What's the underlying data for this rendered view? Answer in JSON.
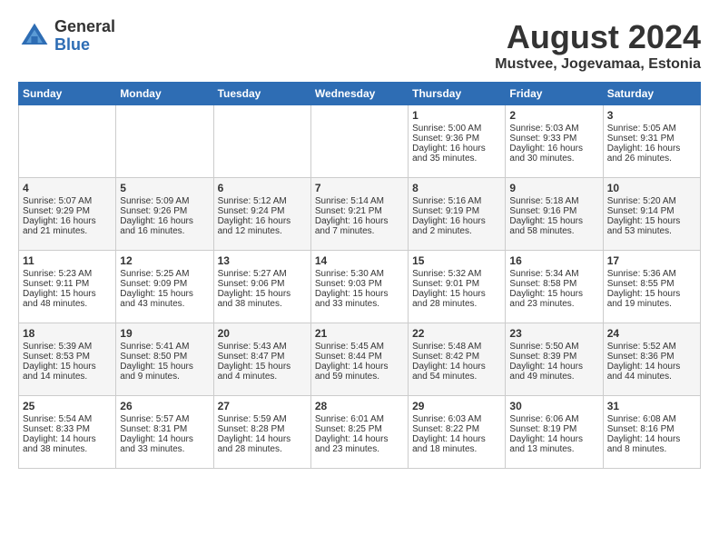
{
  "header": {
    "logo_general": "General",
    "logo_blue": "Blue",
    "month_year": "August 2024",
    "location": "Mustvee, Jogevamaa, Estonia"
  },
  "days_of_week": [
    "Sunday",
    "Monday",
    "Tuesday",
    "Wednesday",
    "Thursday",
    "Friday",
    "Saturday"
  ],
  "weeks": [
    [
      {
        "day": "",
        "content": ""
      },
      {
        "day": "",
        "content": ""
      },
      {
        "day": "",
        "content": ""
      },
      {
        "day": "",
        "content": ""
      },
      {
        "day": "1",
        "content": "Sunrise: 5:00 AM\nSunset: 9:36 PM\nDaylight: 16 hours\nand 35 minutes."
      },
      {
        "day": "2",
        "content": "Sunrise: 5:03 AM\nSunset: 9:33 PM\nDaylight: 16 hours\nand 30 minutes."
      },
      {
        "day": "3",
        "content": "Sunrise: 5:05 AM\nSunset: 9:31 PM\nDaylight: 16 hours\nand 26 minutes."
      }
    ],
    [
      {
        "day": "4",
        "content": "Sunrise: 5:07 AM\nSunset: 9:29 PM\nDaylight: 16 hours\nand 21 minutes."
      },
      {
        "day": "5",
        "content": "Sunrise: 5:09 AM\nSunset: 9:26 PM\nDaylight: 16 hours\nand 16 minutes."
      },
      {
        "day": "6",
        "content": "Sunrise: 5:12 AM\nSunset: 9:24 PM\nDaylight: 16 hours\nand 12 minutes."
      },
      {
        "day": "7",
        "content": "Sunrise: 5:14 AM\nSunset: 9:21 PM\nDaylight: 16 hours\nand 7 minutes."
      },
      {
        "day": "8",
        "content": "Sunrise: 5:16 AM\nSunset: 9:19 PM\nDaylight: 16 hours\nand 2 minutes."
      },
      {
        "day": "9",
        "content": "Sunrise: 5:18 AM\nSunset: 9:16 PM\nDaylight: 15 hours\nand 58 minutes."
      },
      {
        "day": "10",
        "content": "Sunrise: 5:20 AM\nSunset: 9:14 PM\nDaylight: 15 hours\nand 53 minutes."
      }
    ],
    [
      {
        "day": "11",
        "content": "Sunrise: 5:23 AM\nSunset: 9:11 PM\nDaylight: 15 hours\nand 48 minutes."
      },
      {
        "day": "12",
        "content": "Sunrise: 5:25 AM\nSunset: 9:09 PM\nDaylight: 15 hours\nand 43 minutes."
      },
      {
        "day": "13",
        "content": "Sunrise: 5:27 AM\nSunset: 9:06 PM\nDaylight: 15 hours\nand 38 minutes."
      },
      {
        "day": "14",
        "content": "Sunrise: 5:30 AM\nSunset: 9:03 PM\nDaylight: 15 hours\nand 33 minutes."
      },
      {
        "day": "15",
        "content": "Sunrise: 5:32 AM\nSunset: 9:01 PM\nDaylight: 15 hours\nand 28 minutes."
      },
      {
        "day": "16",
        "content": "Sunrise: 5:34 AM\nSunset: 8:58 PM\nDaylight: 15 hours\nand 23 minutes."
      },
      {
        "day": "17",
        "content": "Sunrise: 5:36 AM\nSunset: 8:55 PM\nDaylight: 15 hours\nand 19 minutes."
      }
    ],
    [
      {
        "day": "18",
        "content": "Sunrise: 5:39 AM\nSunset: 8:53 PM\nDaylight: 15 hours\nand 14 minutes."
      },
      {
        "day": "19",
        "content": "Sunrise: 5:41 AM\nSunset: 8:50 PM\nDaylight: 15 hours\nand 9 minutes."
      },
      {
        "day": "20",
        "content": "Sunrise: 5:43 AM\nSunset: 8:47 PM\nDaylight: 15 hours\nand 4 minutes."
      },
      {
        "day": "21",
        "content": "Sunrise: 5:45 AM\nSunset: 8:44 PM\nDaylight: 14 hours\nand 59 minutes."
      },
      {
        "day": "22",
        "content": "Sunrise: 5:48 AM\nSunset: 8:42 PM\nDaylight: 14 hours\nand 54 minutes."
      },
      {
        "day": "23",
        "content": "Sunrise: 5:50 AM\nSunset: 8:39 PM\nDaylight: 14 hours\nand 49 minutes."
      },
      {
        "day": "24",
        "content": "Sunrise: 5:52 AM\nSunset: 8:36 PM\nDaylight: 14 hours\nand 44 minutes."
      }
    ],
    [
      {
        "day": "25",
        "content": "Sunrise: 5:54 AM\nSunset: 8:33 PM\nDaylight: 14 hours\nand 38 minutes."
      },
      {
        "day": "26",
        "content": "Sunrise: 5:57 AM\nSunset: 8:31 PM\nDaylight: 14 hours\nand 33 minutes."
      },
      {
        "day": "27",
        "content": "Sunrise: 5:59 AM\nSunset: 8:28 PM\nDaylight: 14 hours\nand 28 minutes."
      },
      {
        "day": "28",
        "content": "Sunrise: 6:01 AM\nSunset: 8:25 PM\nDaylight: 14 hours\nand 23 minutes."
      },
      {
        "day": "29",
        "content": "Sunrise: 6:03 AM\nSunset: 8:22 PM\nDaylight: 14 hours\nand 18 minutes."
      },
      {
        "day": "30",
        "content": "Sunrise: 6:06 AM\nSunset: 8:19 PM\nDaylight: 14 hours\nand 13 minutes."
      },
      {
        "day": "31",
        "content": "Sunrise: 6:08 AM\nSunset: 8:16 PM\nDaylight: 14 hours\nand 8 minutes."
      }
    ]
  ]
}
